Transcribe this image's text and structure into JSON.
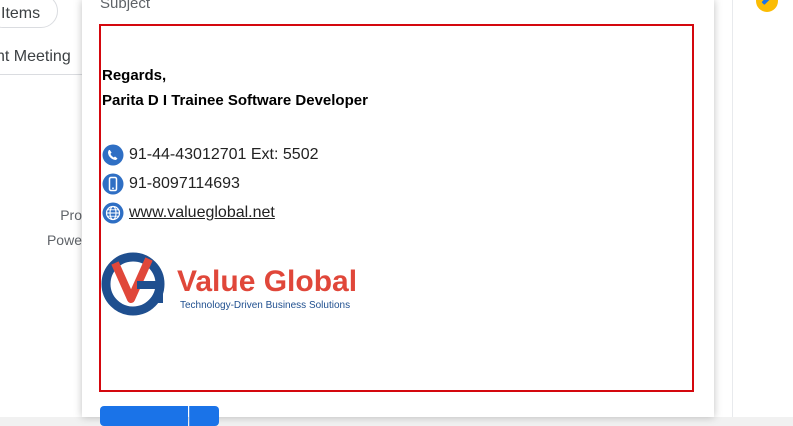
{
  "left_panel": {
    "items_chip": "Items",
    "meeting_tab": "nt Meeting",
    "text_1": "Pro",
    "text_2": "Powe"
  },
  "compose": {
    "subject_placeholder": "Subject",
    "signature": {
      "regards": "Regards,",
      "name_line": "Parita D I Trainee Software Developer",
      "phone": "91-44-43012701 Ext: 5502",
      "mobile": "91-8097114693",
      "website": "www.valueglobal.net",
      "logo_brand": "Value Global",
      "logo_tagline": "Technology-Driven Business Solutions"
    }
  },
  "colors": {
    "body_border": "#d4080e",
    "send_button": "#1a73e8",
    "logo_red": "#e0473a",
    "logo_blue": "#1f4f8f"
  }
}
